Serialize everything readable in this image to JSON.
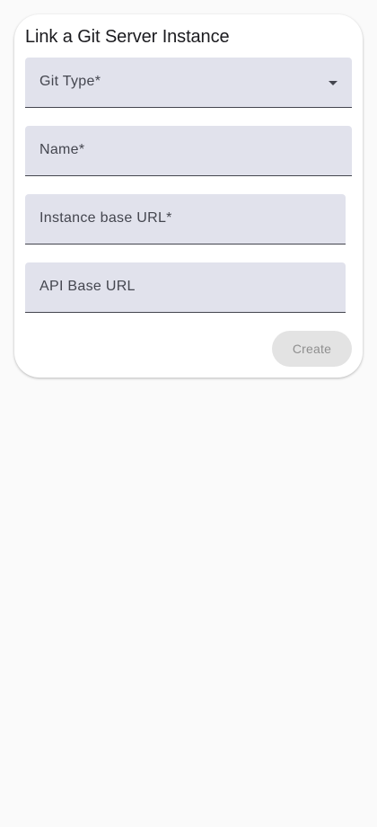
{
  "dialog": {
    "title": "Link a Git Server Instance",
    "fields": [
      {
        "label": "Git Type*",
        "type": "select",
        "value": ""
      },
      {
        "label": "Name*",
        "type": "text",
        "value": ""
      },
      {
        "label": "Instance base URL*",
        "type": "text",
        "value": ""
      },
      {
        "label": "API Base URL",
        "type": "text",
        "value": ""
      }
    ],
    "create_label": "Create",
    "create_disabled": true
  },
  "colors": {
    "page_background": "#fafafa",
    "field_fill": "#e1e2ec",
    "field_underline": "#44464f",
    "disabled_button_fill": "#e3e3e3",
    "disabled_button_text": "#8f8f8f"
  }
}
